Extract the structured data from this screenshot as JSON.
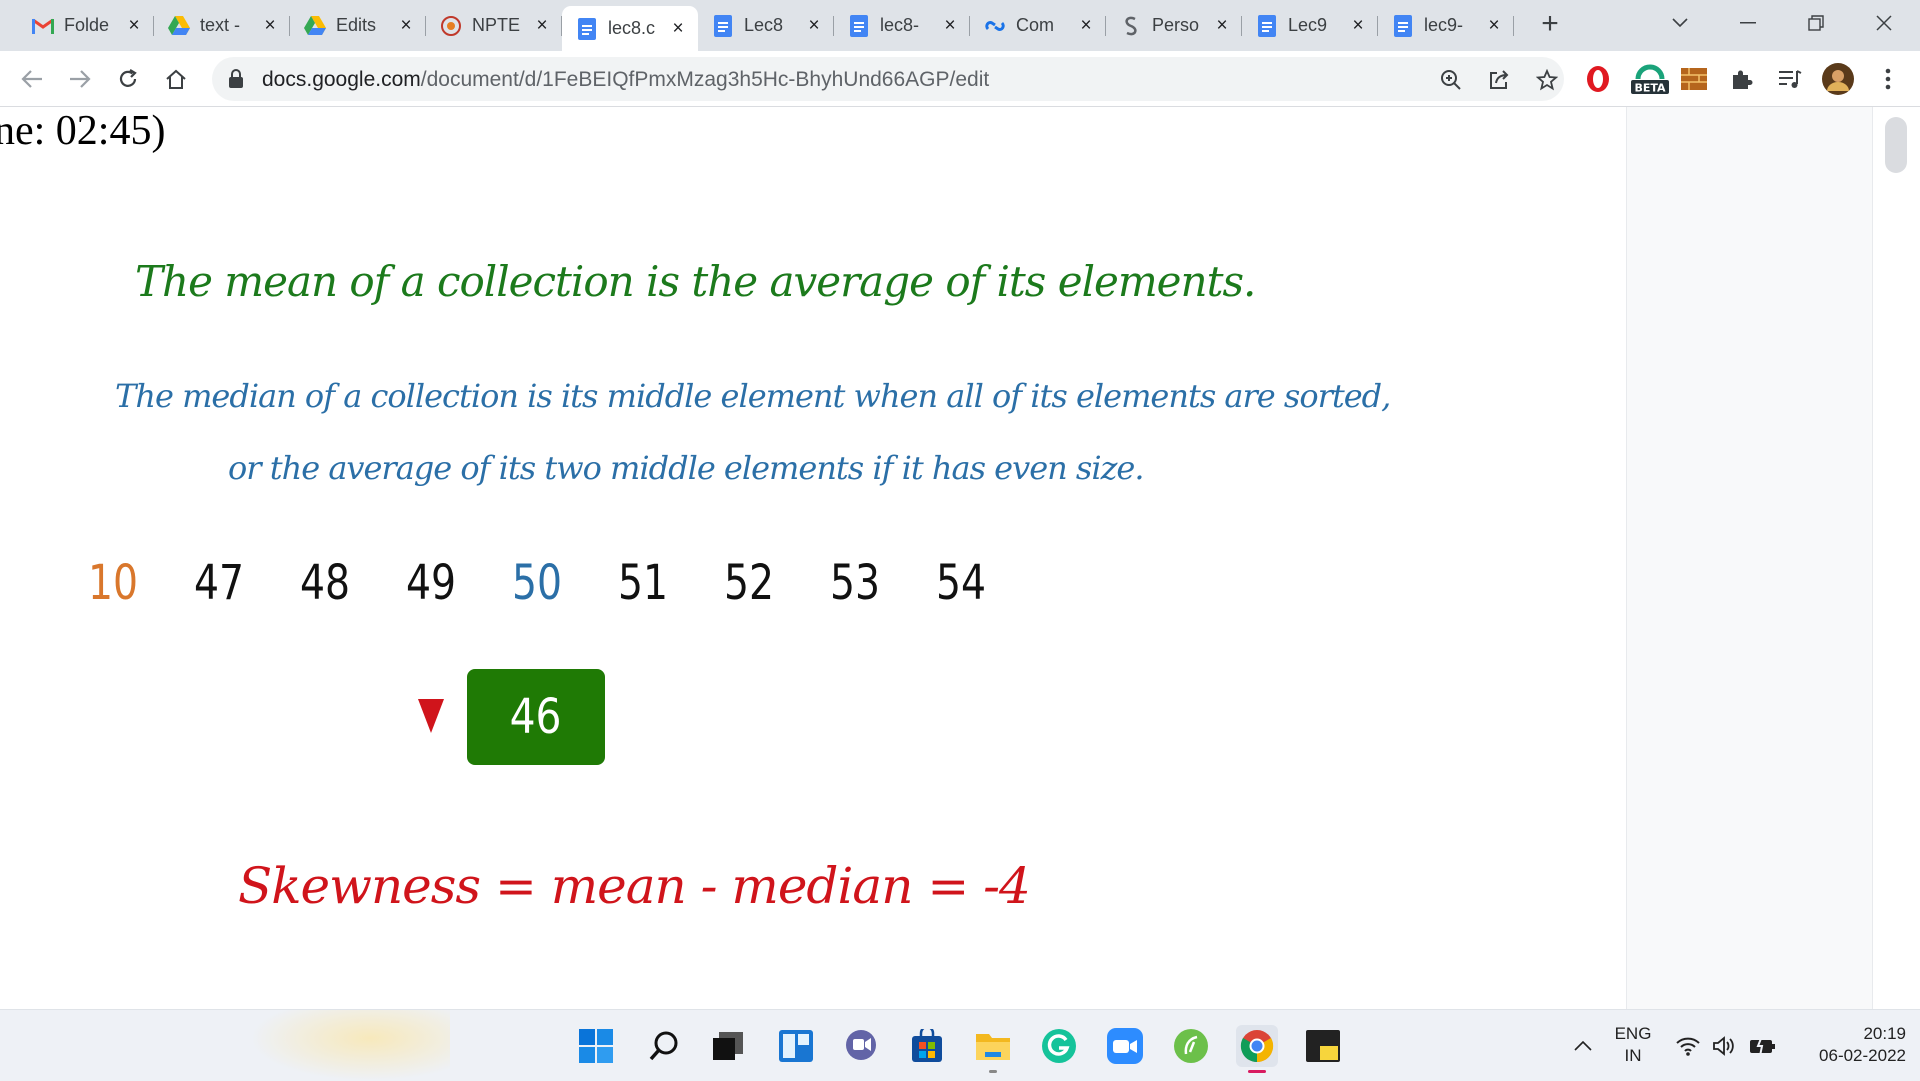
{
  "tabs": [
    {
      "title": "Folde",
      "icon": "gmail-icon",
      "active": false
    },
    {
      "title": "text -",
      "icon": "google-drive-icon",
      "active": false
    },
    {
      "title": "Edits",
      "icon": "google-drive-icon",
      "active": false
    },
    {
      "title": "NPTE",
      "icon": "nptel-icon",
      "active": false
    },
    {
      "title": "lec8.c",
      "icon": "google-docs-icon",
      "active": true
    },
    {
      "title": "Lec8",
      "icon": "google-docs-icon",
      "active": false
    },
    {
      "title": "lec8-",
      "icon": "google-docs-icon",
      "active": false
    },
    {
      "title": "Com",
      "icon": "link-icon",
      "active": false
    },
    {
      "title": "Perso",
      "icon": "infinity-icon",
      "active": false
    },
    {
      "title": "Lec9",
      "icon": "google-docs-icon",
      "active": false
    },
    {
      "title": "lec9-",
      "icon": "google-docs-icon",
      "active": false
    }
  ],
  "address_bar": {
    "host": "docs.google.com",
    "path": "/document/d/1FeBEIQfPmxMzag3h5Hc-BhyhUnd66AGP/edit"
  },
  "extensions": {
    "beta_badge": "BETA"
  },
  "document": {
    "time_fragment": "ne: 02:45)",
    "mean_definition": "The mean of a collection is the average of its elements.",
    "median_definition_line1": "The median of a collection is its middle element when all of its elements are sorted,",
    "median_definition_line2": "or the average of its two middle elements if it has even size.",
    "numbers": [
      {
        "value": "10",
        "color": "#d9772c"
      },
      {
        "value": "47",
        "color": "#111111"
      },
      {
        "value": "48",
        "color": "#111111"
      },
      {
        "value": "49",
        "color": "#111111"
      },
      {
        "value": "50",
        "color": "#2b6fa7"
      },
      {
        "value": "51",
        "color": "#111111"
      },
      {
        "value": "52",
        "color": "#111111"
      },
      {
        "value": "53",
        "color": "#111111"
      },
      {
        "value": "54",
        "color": "#111111"
      }
    ],
    "mean_value": "46",
    "skewness": "Skewness = mean - median = -4",
    "colors": {
      "mean": "#1c7a1c",
      "median": "#2b6fa7",
      "skew": "#d0141b",
      "mean_box": "#1f7a05"
    }
  },
  "taskbar": {
    "language_line1": "ENG",
    "language_line2": "IN",
    "time": "20:19",
    "date": "06-02-2022",
    "apps": [
      "windows-start-icon",
      "search-icon",
      "task-view-icon",
      "widgets-icon",
      "teams-chat-icon",
      "microsoft-store-icon",
      "file-explorer-icon",
      "grammarly-icon",
      "zoom-icon",
      "evernote-icon",
      "chrome-icon",
      "sticky-notes-icon"
    ]
  }
}
